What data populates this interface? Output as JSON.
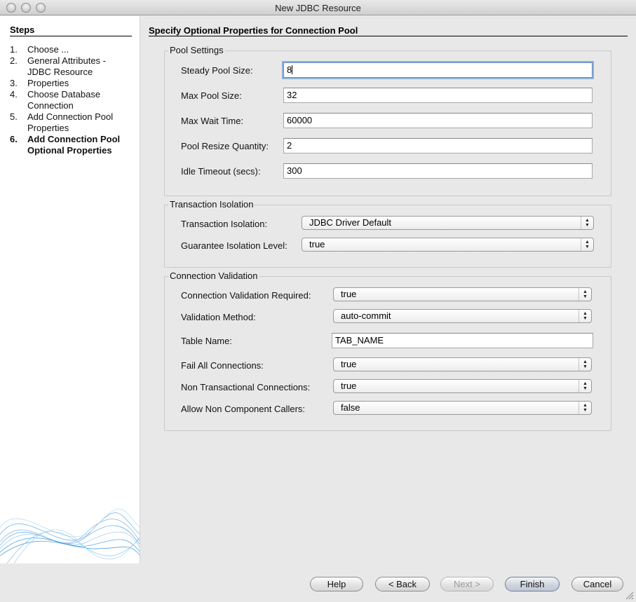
{
  "window": {
    "title": "New JDBC Resource"
  },
  "steps": {
    "heading": "Steps",
    "items": [
      {
        "num": "1.",
        "label": "Choose ...",
        "active": false
      },
      {
        "num": "2.",
        "label": "General Attributes - JDBC Resource",
        "active": false
      },
      {
        "num": "3.",
        "label": "Properties",
        "active": false
      },
      {
        "num": "4.",
        "label": "Choose Database Connection",
        "active": false
      },
      {
        "num": "5.",
        "label": "Add Connection Pool Properties",
        "active": false
      },
      {
        "num": "6.",
        "label": "Add Connection Pool Optional Properties",
        "active": true
      }
    ]
  },
  "main": {
    "title": "Specify Optional Properties for Connection Pool"
  },
  "pool_settings": {
    "title": "Pool Settings",
    "steady_pool_size_label": "Steady Pool Size:",
    "steady_pool_size_value": "8",
    "max_pool_size_label": "Max Pool Size:",
    "max_pool_size_value": "32",
    "max_wait_time_label": "Max Wait Time:",
    "max_wait_time_value": "60000",
    "pool_resize_quantity_label": "Pool Resize Quantity:",
    "pool_resize_quantity_value": "2",
    "idle_timeout_label": "Idle Timeout (secs):",
    "idle_timeout_value": "300"
  },
  "transaction_isolation": {
    "title": "Transaction Isolation",
    "isolation_label": "Transaction Isolation:",
    "isolation_value": "JDBC Driver Default",
    "guarantee_label": "Guarantee Isolation Level:",
    "guarantee_value": "true"
  },
  "connection_validation": {
    "title": "Connection Validation",
    "required_label": "Connection Validation Required:",
    "required_value": "true",
    "method_label": "Validation Method:",
    "method_value": "auto-commit",
    "table_name_label": "Table Name:",
    "table_name_value": "TAB_NAME",
    "fail_all_label": "Fail All Connections:",
    "fail_all_value": "true",
    "non_transactional_label": "Non Transactional Connections:",
    "non_transactional_value": "true",
    "allow_non_component_label": "Allow Non Component Callers:",
    "allow_non_component_value": "false"
  },
  "buttons": {
    "help": "Help",
    "back": "< Back",
    "next": "Next >",
    "finish": "Finish",
    "cancel": "Cancel"
  },
  "colors": {
    "focus_ring": "#8fb0d6",
    "panel_bg": "#e8e8e8",
    "steps_bg": "#ffffff"
  }
}
